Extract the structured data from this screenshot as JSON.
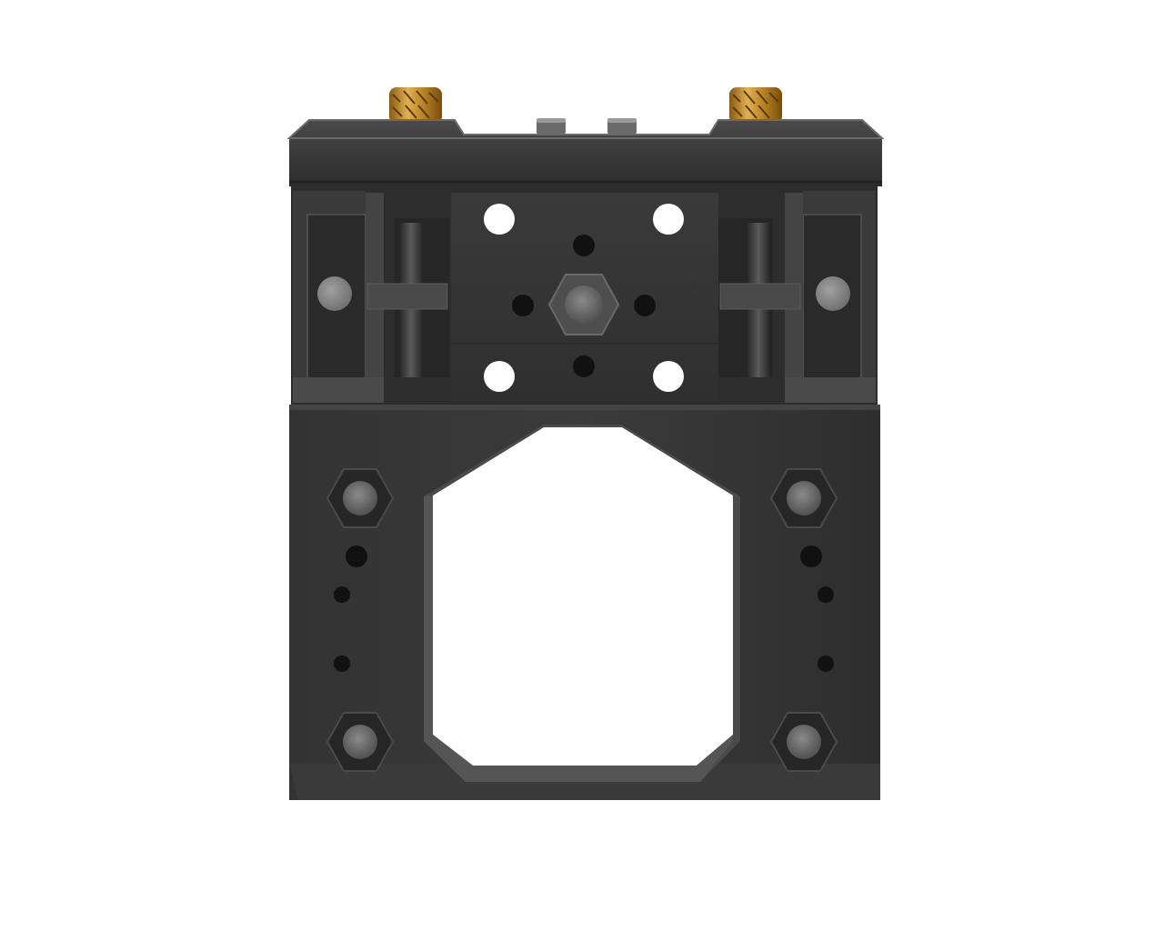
{
  "image": {
    "subject": "black-machined-3d-printer-carriage-mount-render",
    "background_color": "#ffffff",
    "colors": {
      "body_dark": "#2f2f2f",
      "body_mid": "#3a3a3a",
      "body_light": "#4a4a4a",
      "edge_highlight": "#5a5a5a",
      "brass_insert": "#c8952f",
      "steel_pin": "#8a8a8a",
      "hole": "#111111"
    },
    "components": {
      "brass_inserts": 2,
      "top_pins": 2,
      "side_rods": 2,
      "side_buttons": 2,
      "corner_hex_nuts": 4,
      "center_hex_nut": 1,
      "through_holes_white": 4
    }
  }
}
